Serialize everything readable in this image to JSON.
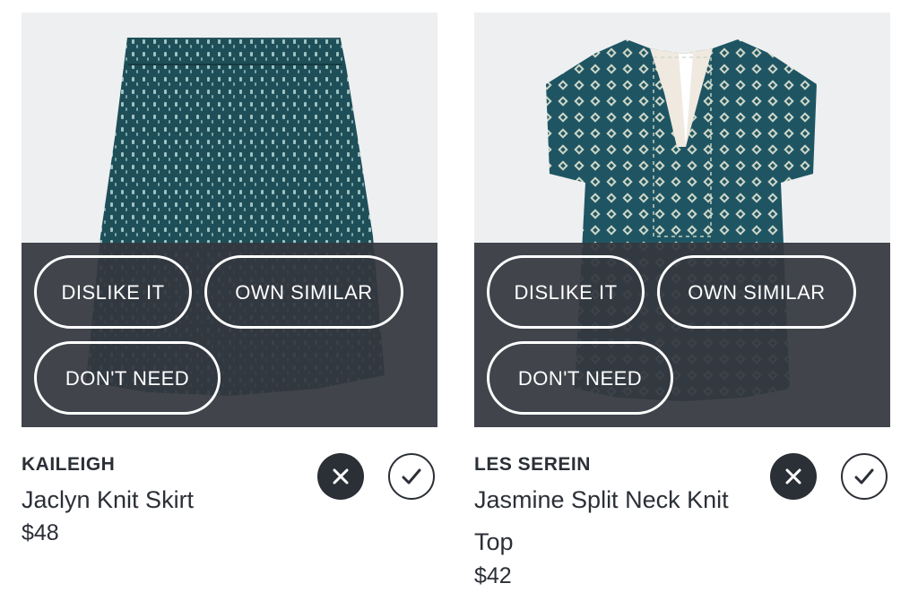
{
  "actions": {
    "dislike": "DISLIKE IT",
    "own_similar": "OWN SIMILAR",
    "dont_need": "DON'T NEED"
  },
  "items": [
    {
      "brand": "KAILEIGH",
      "name": "Jaclyn Knit Skirt",
      "price": "$48",
      "image_icon": "skirt-image"
    },
    {
      "brand": "LES SEREIN",
      "name": "Jasmine Split Neck Knit Top",
      "price": "$42",
      "image_icon": "top-image"
    }
  ],
  "colors": {
    "overlay": "#34373e",
    "text": "#2b2f36",
    "garment": "#1e4f58"
  }
}
